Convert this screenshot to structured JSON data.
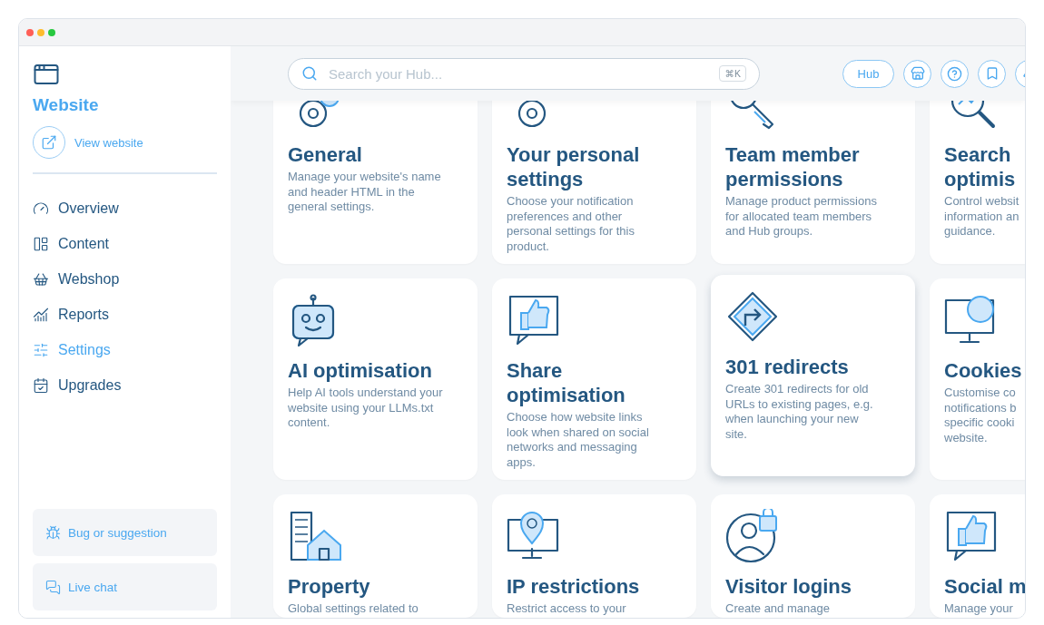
{
  "window": {
    "traffic_lights": [
      {
        "color": "#ff5f57"
      },
      {
        "color": "#febc2e"
      },
      {
        "color": "#28c840"
      }
    ]
  },
  "sidebar": {
    "title": "Website",
    "view_link": "View website",
    "nav": [
      {
        "label": "Overview",
        "selected": false
      },
      {
        "label": "Content",
        "selected": false
      },
      {
        "label": "Webshop",
        "selected": false
      },
      {
        "label": "Reports",
        "selected": false
      },
      {
        "label": "Settings",
        "selected": true
      },
      {
        "label": "Upgrades",
        "selected": false
      }
    ],
    "footer_buttons": [
      "Bug or suggestion",
      "Live chat"
    ]
  },
  "header": {
    "search": {
      "placeholder": "Search your Hub...",
      "shortcut": "⌘K"
    },
    "hub_button": "Hub"
  },
  "cards": [
    {
      "title": [
        "General"
      ],
      "description": [
        "Manage your website's name",
        "and header HTML in the",
        "general settings."
      ],
      "hovered": false
    },
    {
      "title": [
        "Your personal",
        "settings"
      ],
      "description": [
        "Choose your notification",
        "preferences and other",
        "personal settings for this",
        "product."
      ],
      "hovered": false
    },
    {
      "title": [
        "Team member",
        "permissions"
      ],
      "description": [
        "Manage product permissions",
        "for allocated team members",
        "and Hub groups."
      ],
      "hovered": false
    },
    {
      "title": [
        "Search",
        "optimis"
      ],
      "description": [
        "Control websit",
        "information an",
        "guidance."
      ],
      "hovered": false
    },
    {
      "title": [
        "AI optimisation"
      ],
      "description": [
        "Help AI tools understand your",
        "website using your LLMs.txt",
        "content."
      ],
      "hovered": false
    },
    {
      "title": [
        "Share",
        "optimisation"
      ],
      "description": [
        "Choose how website links",
        "look when shared on social",
        "networks and messaging",
        "apps."
      ],
      "hovered": false
    },
    {
      "title": [
        "301 redirects"
      ],
      "description": [
        "Create 301 redirects for old",
        "URLs to existing pages, e.g.",
        "when launching your new",
        "site."
      ],
      "hovered": true
    },
    {
      "title": [
        "Cookies"
      ],
      "description": [
        "Customise co",
        "notifications b",
        "specific cooki",
        "website."
      ],
      "hovered": false
    },
    {
      "title": [
        "Property"
      ],
      "description": [
        "Global settings related to"
      ],
      "hovered": false
    },
    {
      "title": [
        "IP restrictions"
      ],
      "description": [
        "Restrict access to your"
      ],
      "hovered": false
    },
    {
      "title": [
        "Visitor logins"
      ],
      "description": [
        "Create and manage"
      ],
      "hovered": false
    },
    {
      "title": [
        "Social m"
      ],
      "description": [
        "Manage your"
      ],
      "hovered": false
    }
  ]
}
